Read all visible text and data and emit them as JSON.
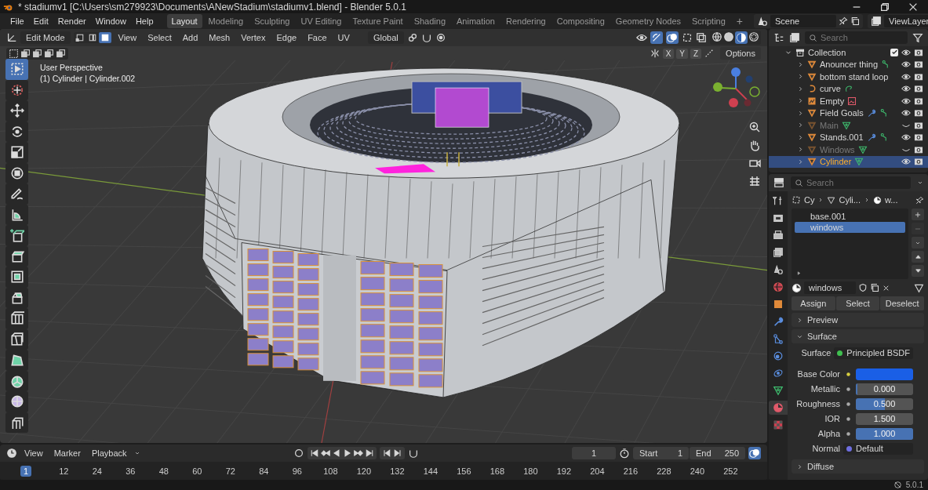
{
  "window": {
    "title": "* stadiumv1 [C:\\Users\\sm279923\\Documents\\ANewStadium\\stadiumv1.blend] - Blender 5.0.1"
  },
  "menu": [
    "File",
    "Edit",
    "Render",
    "Window",
    "Help"
  ],
  "workspaces": [
    {
      "label": "Layout",
      "selected": true
    },
    {
      "label": "Modeling",
      "selected": false
    },
    {
      "label": "Sculpting",
      "selected": false
    },
    {
      "label": "UV Editing",
      "selected": false
    },
    {
      "label": "Texture Paint",
      "selected": false
    },
    {
      "label": "Shading",
      "selected": false
    },
    {
      "label": "Animation",
      "selected": false
    },
    {
      "label": "Rendering",
      "selected": false
    },
    {
      "label": "Compositing",
      "selected": false
    },
    {
      "label": "Geometry Nodes",
      "selected": false
    },
    {
      "label": "Scripting",
      "selected": false
    }
  ],
  "add_workspace": "+",
  "scene": "Scene",
  "view_layer": "ViewLayer",
  "header": {
    "mode": "Edit Mode",
    "select_modes": [
      {
        "kind": "vertex",
        "selected": false
      },
      {
        "kind": "edge",
        "selected": false
      },
      {
        "kind": "face",
        "selected": true
      }
    ],
    "menus": [
      "View",
      "Select",
      "Add",
      "Mesh",
      "Vertex",
      "Edge",
      "Face",
      "UV"
    ],
    "orientation": "Global"
  },
  "viewport": {
    "view_name": "User Perspective",
    "object_info": "(1) Cylinder | Cylinder.002",
    "axis_buttons": [
      "X",
      "Y",
      "Z"
    ],
    "options": "Options",
    "tools": [
      {
        "kind": "select",
        "selected": true
      },
      {
        "kind": "cursor",
        "selected": false
      },
      {
        "kind": "move",
        "selected": false
      },
      {
        "kind": "rotate",
        "selected": false
      },
      {
        "kind": "scale",
        "selected": false
      },
      {
        "kind": "transform",
        "selected": false
      },
      {
        "kind": "annotate",
        "selected": false
      },
      {
        "kind": "measure",
        "selected": false
      },
      {
        "kind": "add_cube",
        "selected": false
      },
      {
        "kind": "extrude",
        "selected": false
      },
      {
        "kind": "inset",
        "selected": false
      },
      {
        "kind": "bevel",
        "selected": false
      },
      {
        "kind": "loop_cut",
        "selected": false
      },
      {
        "kind": "knife",
        "selected": false
      },
      {
        "kind": "poly_build",
        "selected": false
      },
      {
        "kind": "spin",
        "selected": false
      },
      {
        "kind": "smooth",
        "selected": false
      },
      {
        "kind": "shrink",
        "selected": false
      }
    ]
  },
  "outliner": {
    "search": {
      "placeholder": "Search"
    },
    "collection": {
      "name": "Collection",
      "expanded": true,
      "checked": true,
      "children": [
        {
          "name": "Anouncer thing",
          "kind": "mesh",
          "visible": true,
          "selected": false,
          "extras": [
            {
              "kind": "vertex_group"
            }
          ]
        },
        {
          "name": "bottom stand loop",
          "kind": "mesh",
          "visible": true,
          "selected": false
        },
        {
          "name": "curve",
          "kind": "curve",
          "visible": true,
          "selected": false,
          "extras": [
            {
              "kind": "curve_data"
            }
          ]
        },
        {
          "name": "Empty",
          "kind": "empty",
          "visible": true,
          "selected": false,
          "extras": [
            {
              "kind": "image"
            }
          ]
        },
        {
          "name": "Field Goals",
          "kind": "mesh",
          "visible": true,
          "selected": false,
          "extras": [
            {
              "kind": "modifier"
            },
            {
              "kind": "vertex_group"
            }
          ]
        },
        {
          "name": "Main",
          "kind": "mesh",
          "visible": false,
          "selected": false,
          "extras": [
            {
              "kind": "mesh_data"
            }
          ]
        },
        {
          "name": "Stands.001",
          "kind": "mesh",
          "visible": true,
          "selected": false,
          "extras": [
            {
              "kind": "modifier"
            },
            {
              "kind": "vertex_group"
            }
          ]
        },
        {
          "name": "Windows",
          "kind": "mesh",
          "visible": false,
          "selected": false,
          "extras": [
            {
              "kind": "mesh_data"
            }
          ]
        },
        {
          "name": "Cylinder",
          "kind": "mesh",
          "visible": true,
          "selected": true,
          "extras": [
            {
              "kind": "mesh_data"
            }
          ]
        }
      ]
    }
  },
  "properties": {
    "search": {
      "placeholder": "Search"
    },
    "tabs": [
      {
        "kind": "tool",
        "selected": false
      },
      {
        "kind": "render",
        "selected": false
      },
      {
        "kind": "output",
        "selected": false
      },
      {
        "kind": "view_layer",
        "selected": false
      },
      {
        "kind": "scene",
        "selected": false
      },
      {
        "kind": "world",
        "selected": false
      },
      {
        "kind": "object",
        "selected": false
      },
      {
        "kind": "modifiers",
        "selected": false
      },
      {
        "kind": "particles",
        "selected": false
      },
      {
        "kind": "physics",
        "selected": false
      },
      {
        "kind": "constraints",
        "selected": false
      },
      {
        "kind": "data",
        "selected": false
      },
      {
        "kind": "material",
        "selected": true
      },
      {
        "kind": "texture",
        "selected": false
      }
    ],
    "breadcrumb": [
      "Cy",
      "Cyli...",
      "w..."
    ],
    "material_slots": [
      {
        "name": "base.001",
        "selected": false
      },
      {
        "name": "windows",
        "selected": true
      }
    ],
    "material_name": "windows",
    "slot_buttons": [
      "Assign",
      "Select",
      "Deselect"
    ],
    "panels": [
      {
        "title": "Preview",
        "expanded": false
      },
      {
        "title": "Surface",
        "expanded": true
      }
    ],
    "fields": [
      {
        "label": "Surface",
        "kind": "shader",
        "value": "Principled BSDF",
        "color": "#3fbf4f"
      },
      {
        "label": "Base Color",
        "kind": "color",
        "color": "#1a5fe6"
      },
      {
        "label": "Metallic",
        "kind": "slider",
        "value": "0.000",
        "level": 0
      },
      {
        "label": "Roughness",
        "kind": "slider",
        "value": "0.500",
        "level": 0.5
      },
      {
        "label": "IOR",
        "kind": "number",
        "value": "1.500"
      },
      {
        "label": "Alpha",
        "kind": "slider",
        "value": "1.000",
        "level": 1
      },
      {
        "label": "Normal",
        "kind": "link",
        "value": "Default",
        "color": "#6e6ee0"
      }
    ],
    "next_panel": {
      "title": "Diffuse",
      "expanded": false
    }
  },
  "timeline": {
    "menus": [
      "View",
      "Marker",
      "Playback"
    ],
    "current_frame": "1",
    "start_label": "Start",
    "start": "1",
    "end_label": "End",
    "end": "250",
    "ticks": [
      "12",
      "24",
      "36",
      "48",
      "60",
      "72",
      "84",
      "96",
      "108",
      "120",
      "132",
      "144",
      "156",
      "168",
      "180",
      "192",
      "204",
      "216",
      "228",
      "240",
      "252"
    ],
    "playhead": "1"
  },
  "status_bar": {
    "version": "5.0.1"
  }
}
